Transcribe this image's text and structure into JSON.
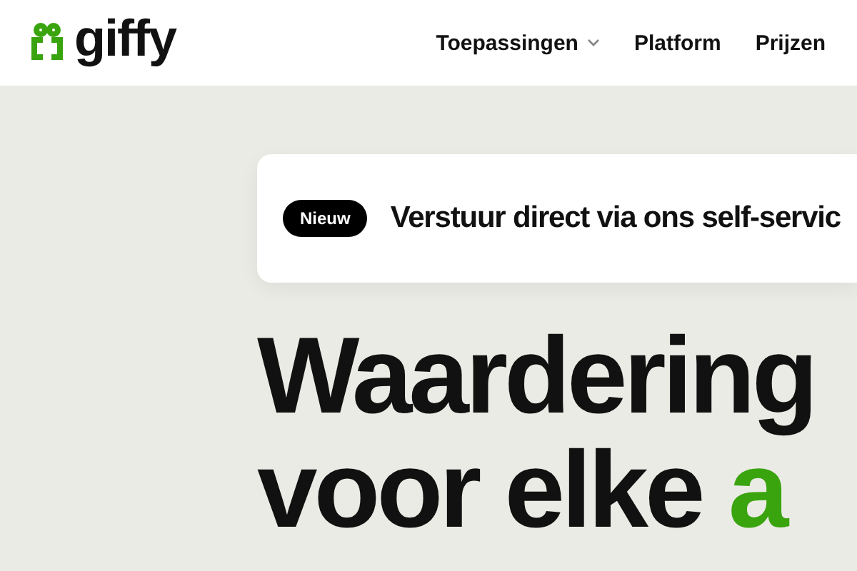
{
  "header": {
    "logo": "giffy",
    "nav": [
      {
        "label": "Toepassingen",
        "kind": "dropdown"
      },
      {
        "label": "Platform",
        "kind": "link"
      },
      {
        "label": "Prijzen",
        "kind": "link"
      }
    ]
  },
  "banner": {
    "badge": "Nieuw",
    "text": "Verstuur direct via ons self-servic"
  },
  "headline": {
    "lines": [
      [
        {
          "text": "Waardering",
          "highlight": false
        }
      ],
      [
        {
          "text": "voor elke ",
          "highlight": false
        },
        {
          "text": "a",
          "highlight": true
        }
      ]
    ]
  }
}
